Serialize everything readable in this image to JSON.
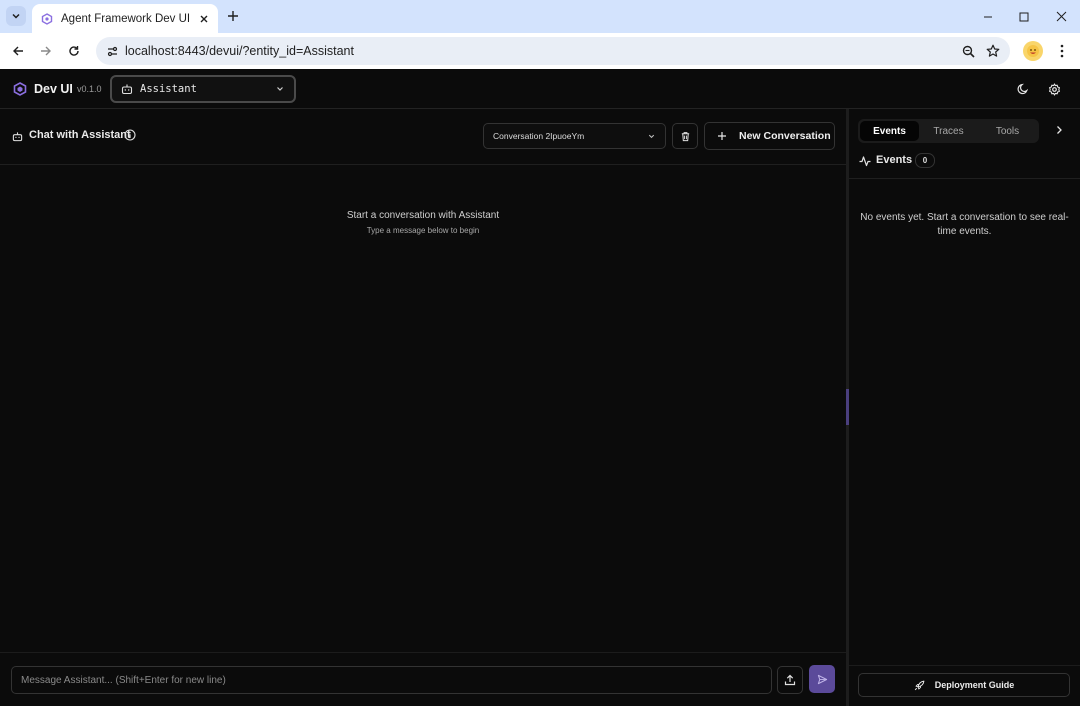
{
  "browser": {
    "tab_title": "Agent Framework Dev UI",
    "url": "localhost:8443/devui/?entity_id=Assistant"
  },
  "header": {
    "title": "Dev UI",
    "version": "v0.1.0",
    "entity": "Assistant"
  },
  "chat": {
    "title": "Chat with Assistant",
    "conversation": "Conversation 2IpuoeYm",
    "new_conversation_label": "New Conversation",
    "empty_title": "Start a conversation with Assistant",
    "empty_subtitle": "Type a message below to begin",
    "input_placeholder": "Message Assistant... (Shift+Enter for new line)"
  },
  "side": {
    "tabs": [
      "Events",
      "Traces",
      "Tools"
    ],
    "active_tab": "Events",
    "events_title": "Events",
    "events_count": "0",
    "events_empty": "No events yet. Start a conversation to see real-time events.",
    "deployment_label": "Deployment Guide"
  },
  "colors": {
    "accent": "#8b6fe0",
    "send_button": "#5b4a9a",
    "background": "#0b0b0b"
  }
}
